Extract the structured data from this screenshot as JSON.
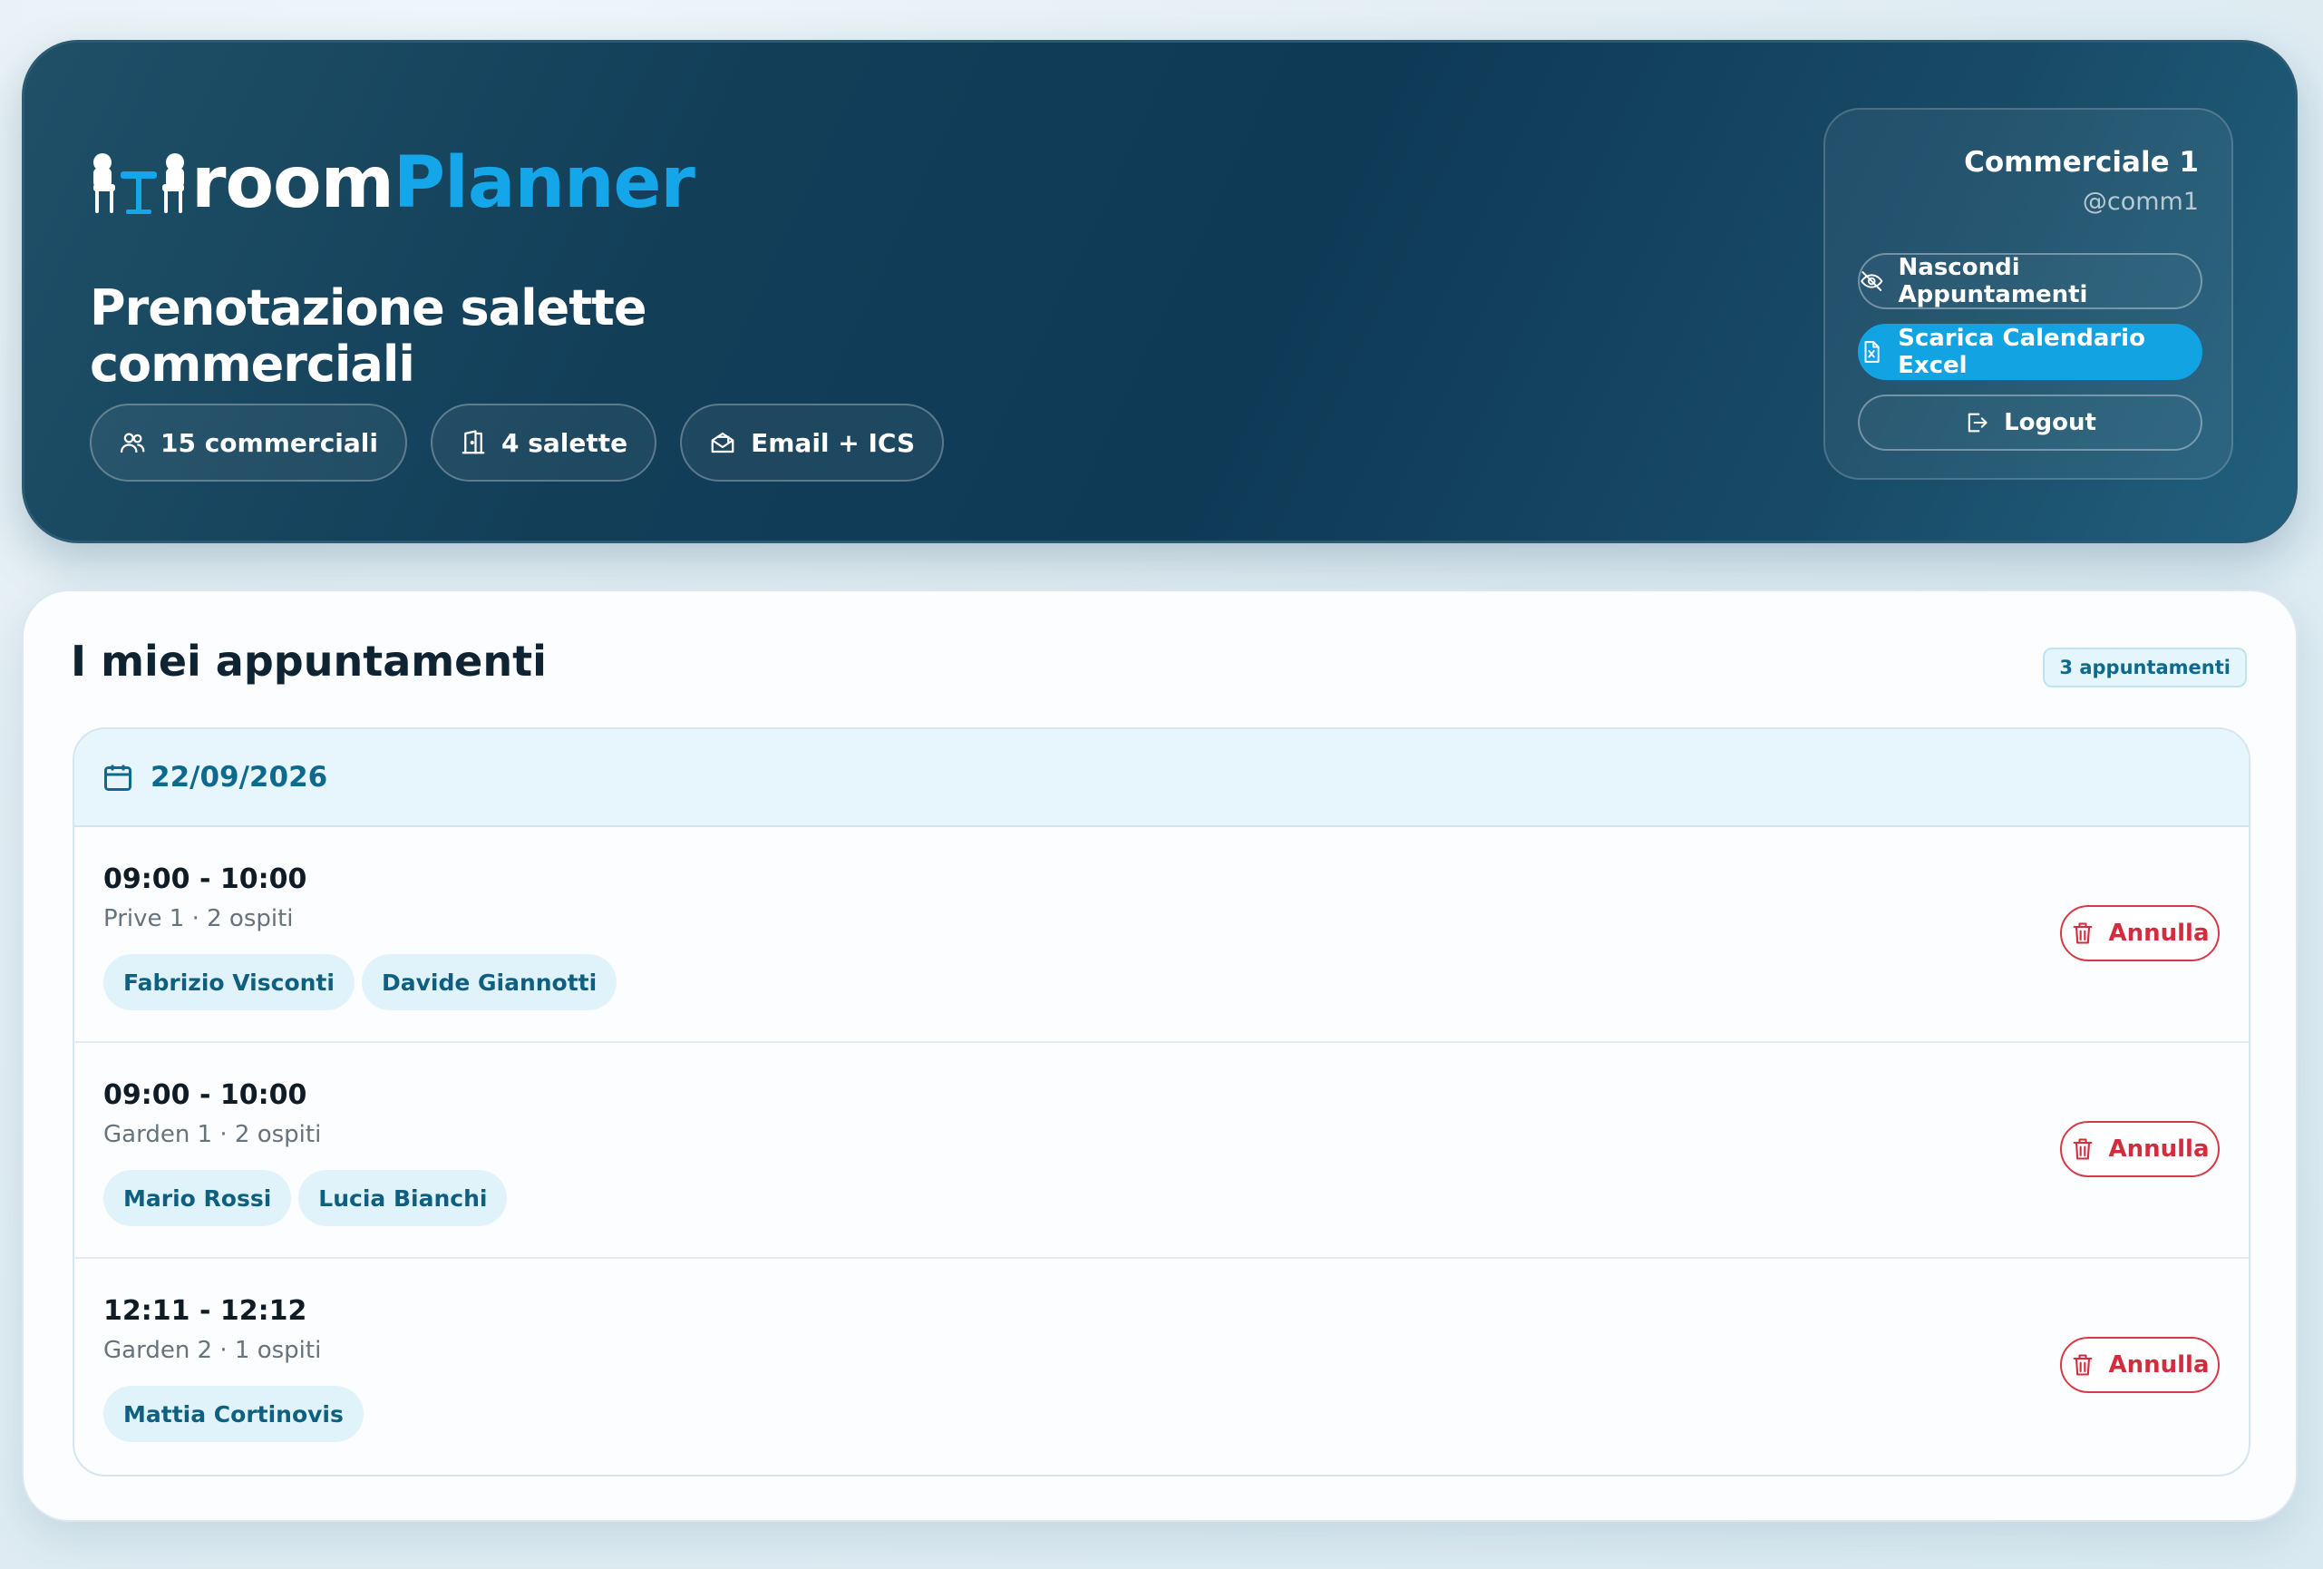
{
  "brand": {
    "name_a": "room",
    "name_b": "Planner"
  },
  "hero": {
    "title": "Prenotazione salette commerciali",
    "chips": [
      {
        "icon": "users-icon",
        "label": "15 commerciali"
      },
      {
        "icon": "door-icon",
        "label": "4 salette"
      },
      {
        "icon": "mail-icon",
        "label": "Email + ICS"
      }
    ]
  },
  "user": {
    "name": "Commerciale 1",
    "handle": "@comm1",
    "hide_label": "Nascondi Appuntamenti",
    "excel_label": "Scarica Calendario Excel",
    "logout_label": "Logout"
  },
  "panel": {
    "title": "I miei appuntamenti",
    "count_label": "3 appuntamenti",
    "date": "22/09/2026",
    "appointments": [
      {
        "time": "09:00 - 10:00",
        "meta": "Prive 1 · 2 ospiti",
        "guests": [
          "Fabrizio Visconti",
          "Davide Giannotti"
        ],
        "cancel_label": "Annulla"
      },
      {
        "time": "09:00 - 10:00",
        "meta": "Garden 1 · 2 ospiti",
        "guests": [
          "Mario Rossi",
          "Lucia Bianchi"
        ],
        "cancel_label": "Annulla"
      },
      {
        "time": "12:11 - 12:12",
        "meta": "Garden 2 · 1 ospiti",
        "guests": [
          "Mattia Cortinovis"
        ],
        "cancel_label": "Annulla"
      }
    ]
  },
  "colors": {
    "accent": "#12a3e3",
    "danger": "#d02e3e",
    "hero_bg": "#0e3a56"
  }
}
